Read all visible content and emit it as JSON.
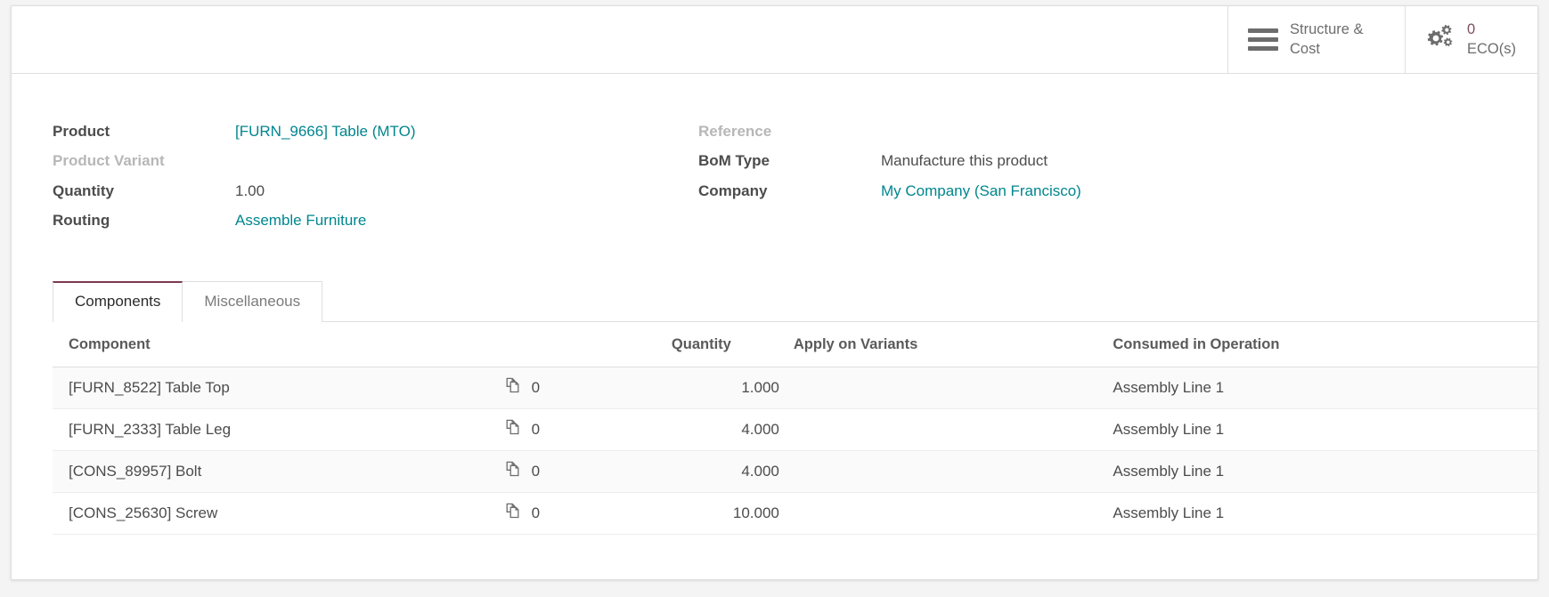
{
  "colors": {
    "link": "#00868e",
    "accent": "#7c3a4e",
    "smart_value": "#7c4e60",
    "text": "#4c4c4c",
    "muted": "#b7b7b7",
    "border": "#dfdfdf"
  },
  "smart_buttons": [
    {
      "name": "structure-and-cost",
      "icon": "hamburger-icon",
      "value": "",
      "label": "Structure & Cost",
      "two_line": true
    },
    {
      "name": "ecos",
      "icon": "gears-icon",
      "value": "0",
      "label": "ECO(s)",
      "two_line": false
    }
  ],
  "form": {
    "left": [
      {
        "label": "Product",
        "value": "[FURN_9666] Table (MTO)",
        "style": "link",
        "label_style": "normal"
      },
      {
        "label": "Product Variant",
        "value": "",
        "style": "empty",
        "label_style": "muted"
      },
      {
        "label": "Quantity",
        "value": "1.00",
        "style": "text",
        "label_style": "normal"
      },
      {
        "label": "Routing",
        "value": "Assemble Furniture",
        "style": "link",
        "label_style": "normal"
      }
    ],
    "right": [
      {
        "label": "Reference",
        "value": "",
        "style": "empty",
        "label_style": "muted"
      },
      {
        "label": "BoM Type",
        "value": "Manufacture this product",
        "style": "text",
        "label_style": "normal"
      },
      {
        "label": "Company",
        "value": "My Company (San Francisco)",
        "style": "link",
        "label_style": "normal"
      },
      {
        "label": "",
        "value": "",
        "style": "empty",
        "label_style": "normal"
      }
    ]
  },
  "tabs": [
    {
      "label": "Components",
      "active": true
    },
    {
      "label": "Miscellaneous",
      "active": false
    }
  ],
  "table": {
    "headers": {
      "component": "Component",
      "variants_icon": "",
      "quantity": "Quantity",
      "apply_on_variants": "Apply on Variants",
      "consumed_in_operation": "Consumed in Operation"
    },
    "rows": [
      {
        "component": "[FURN_8522] Table Top",
        "variant_icon": "copy-icon",
        "variant_count": "0",
        "quantity": "1.000",
        "apply_on_variants": "",
        "consumed_in_operation": "Assembly Line 1"
      },
      {
        "component": "[FURN_2333] Table Leg",
        "variant_icon": "copy-icon",
        "variant_count": "0",
        "quantity": "4.000",
        "apply_on_variants": "",
        "consumed_in_operation": "Assembly Line 1"
      },
      {
        "component": "[CONS_89957] Bolt",
        "variant_icon": "copy-icon",
        "variant_count": "0",
        "quantity": "4.000",
        "apply_on_variants": "",
        "consumed_in_operation": "Assembly Line 1"
      },
      {
        "component": "[CONS_25630] Screw",
        "variant_icon": "copy-icon",
        "variant_count": "0",
        "quantity": "10.000",
        "apply_on_variants": "",
        "consumed_in_operation": "Assembly Line 1"
      }
    ]
  }
}
